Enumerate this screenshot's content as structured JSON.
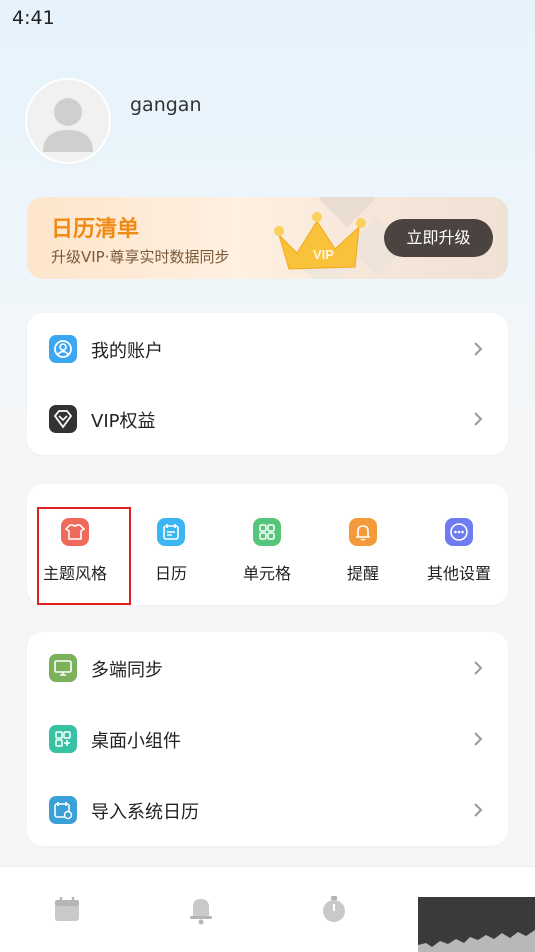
{
  "status_bar": {
    "time": "4:41"
  },
  "profile": {
    "username": "gangan"
  },
  "vip_banner": {
    "title": "日历清单",
    "subtitle": "升级VIP·尊享实时数据同步",
    "crown_text": "VIP",
    "button_label": "立即升级"
  },
  "account_card": {
    "items": [
      {
        "label": "我的账户",
        "icon": "account-icon",
        "color": "#3aa7f0"
      },
      {
        "label": "VIP权益",
        "icon": "vip-diamond-icon",
        "color": "#333333"
      }
    ]
  },
  "quick_grid": {
    "items": [
      {
        "label": "主题风格",
        "icon": "shirt-icon",
        "color": "#f06a5b"
      },
      {
        "label": "日历",
        "icon": "calendar-icon",
        "color": "#3bb6f2"
      },
      {
        "label": "单元格",
        "icon": "grid-cells-icon",
        "color": "#54c77a"
      },
      {
        "label": "提醒",
        "icon": "bell-icon",
        "color": "#f59a3a"
      },
      {
        "label": "其他设置",
        "icon": "more-icon",
        "color": "#6f7cf0"
      }
    ]
  },
  "settings_card": {
    "items": [
      {
        "label": "多端同步",
        "icon": "sync-devices-icon",
        "color": "#7ab15a"
      },
      {
        "label": "桌面小组件",
        "icon": "widget-icon",
        "color": "#36c2a3"
      },
      {
        "label": "导入系统日历",
        "icon": "import-calendar-icon",
        "color": "#3aa0d8"
      }
    ]
  },
  "bottom_nav": {
    "items": [
      {
        "icon": "calendar-tab-icon"
      },
      {
        "icon": "bell-tab-icon"
      },
      {
        "icon": "timer-tab-icon"
      }
    ]
  }
}
